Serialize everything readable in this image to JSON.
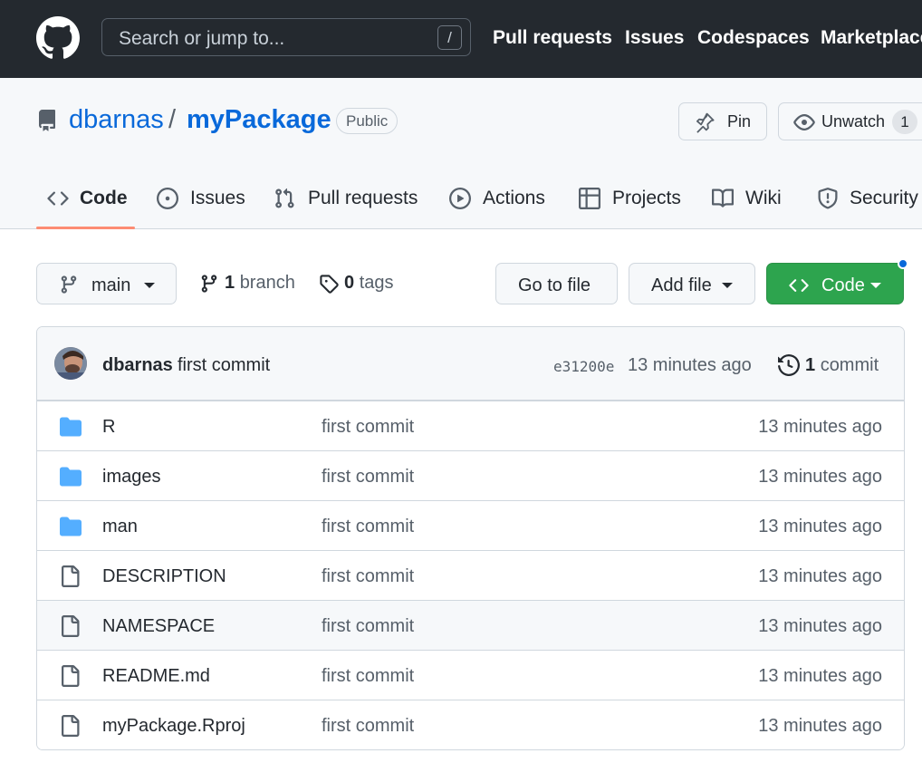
{
  "header": {
    "search_placeholder": "Search or jump to...",
    "search_shortcut": "/",
    "nav": [
      "Pull requests",
      "Issues",
      "Codespaces",
      "Marketplace"
    ]
  },
  "repo": {
    "owner": "dbarnas",
    "separator": "/",
    "name": "myPackage",
    "visibility": "Public",
    "pin_label": "Pin",
    "watch_label": "Unwatch",
    "watch_count": "1"
  },
  "tabs": [
    {
      "label": "Code",
      "icon": "code-icon"
    },
    {
      "label": "Issues",
      "icon": "issue-icon"
    },
    {
      "label": "Pull requests",
      "icon": "pull-request-icon"
    },
    {
      "label": "Actions",
      "icon": "play-icon"
    },
    {
      "label": "Projects",
      "icon": "table-icon"
    },
    {
      "label": "Wiki",
      "icon": "book-icon"
    },
    {
      "label": "Security",
      "icon": "shield-icon"
    }
  ],
  "toolbar": {
    "branch": "main",
    "branch_count": "1",
    "branch_word": "branch",
    "tag_count": "0",
    "tag_word": "tags",
    "go_to_file": "Go to file",
    "add_file": "Add file",
    "code": "Code"
  },
  "commit": {
    "author": "dbarnas",
    "message": "first commit",
    "sha": "e31200e",
    "time": "13 minutes ago",
    "count": "1",
    "count_word": "commit"
  },
  "files": [
    {
      "name": "R",
      "type": "folder",
      "message": "first commit",
      "time": "13 minutes ago"
    },
    {
      "name": "images",
      "type": "folder",
      "message": "first commit",
      "time": "13 minutes ago"
    },
    {
      "name": "man",
      "type": "folder",
      "message": "first commit",
      "time": "13 minutes ago"
    },
    {
      "name": "DESCRIPTION",
      "type": "file",
      "message": "first commit",
      "time": "13 minutes ago"
    },
    {
      "name": "NAMESPACE",
      "type": "file",
      "message": "first commit",
      "time": "13 minutes ago"
    },
    {
      "name": "README.md",
      "type": "file",
      "message": "first commit",
      "time": "13 minutes ago"
    },
    {
      "name": "myPackage.Rproj",
      "type": "file",
      "message": "first commit",
      "time": "13 minutes ago"
    }
  ],
  "colors": {
    "header_bg": "#24292f",
    "link": "#0969da",
    "code_button": "#2da44e",
    "tab_underline": "#fd8c73",
    "folder": "#54aeff"
  }
}
